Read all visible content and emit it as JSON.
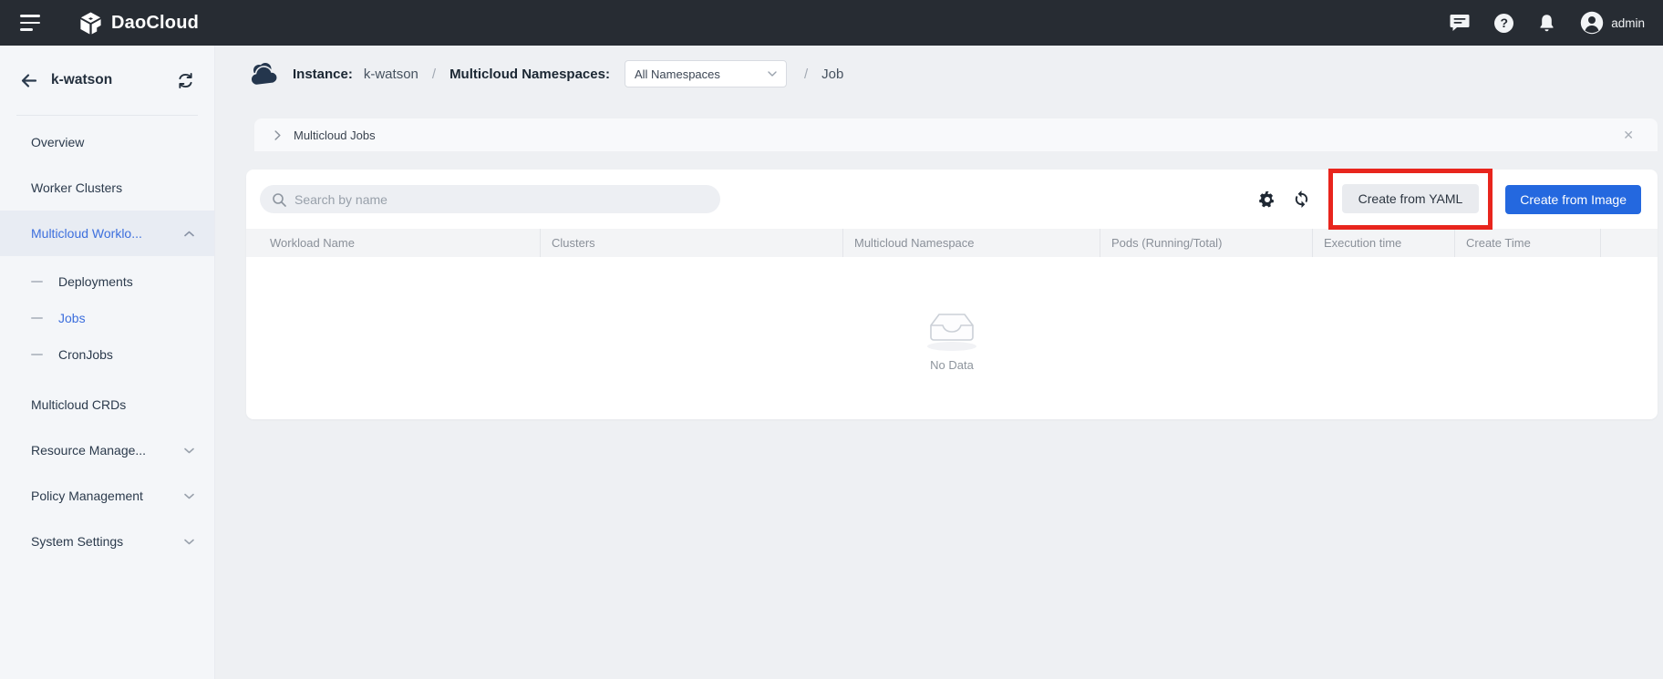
{
  "topbar": {
    "brand": "DaoCloud",
    "user": "admin"
  },
  "sidebar": {
    "title": "k-watson",
    "items": [
      {
        "label": "Overview"
      },
      {
        "label": "Worker Clusters"
      },
      {
        "label": "Multicloud Worklo..."
      },
      {
        "label": "Deployments"
      },
      {
        "label": "Jobs"
      },
      {
        "label": "CronJobs"
      },
      {
        "label": "Multicloud CRDs"
      },
      {
        "label": "Resource Manage..."
      },
      {
        "label": "Policy Management"
      },
      {
        "label": "System Settings"
      }
    ]
  },
  "header": {
    "instance_label": "Instance:",
    "instance_value": "k-watson",
    "separator": "/",
    "namespaces_label": "Multicloud Namespaces:",
    "namespace_selected": "All Namespaces",
    "page": "Job"
  },
  "tabbar": {
    "title": "Multicloud Jobs",
    "close_glyph": "✕"
  },
  "toolbar": {
    "search_placeholder": "Search by name",
    "create_yaml_label": "Create from YAML",
    "create_image_label": "Create from Image"
  },
  "table": {
    "columns": [
      "Workload Name",
      "Clusters",
      "Multicloud Namespace",
      "Pods (Running/Total)",
      "Execution time",
      "Create Time"
    ],
    "empty_text": "No Data"
  },
  "colors": {
    "accent_blue": "#3d6fdd",
    "primary_button_blue": "#2468df",
    "highlight_red": "#e8251d",
    "topbar_bg": "#272c33"
  }
}
